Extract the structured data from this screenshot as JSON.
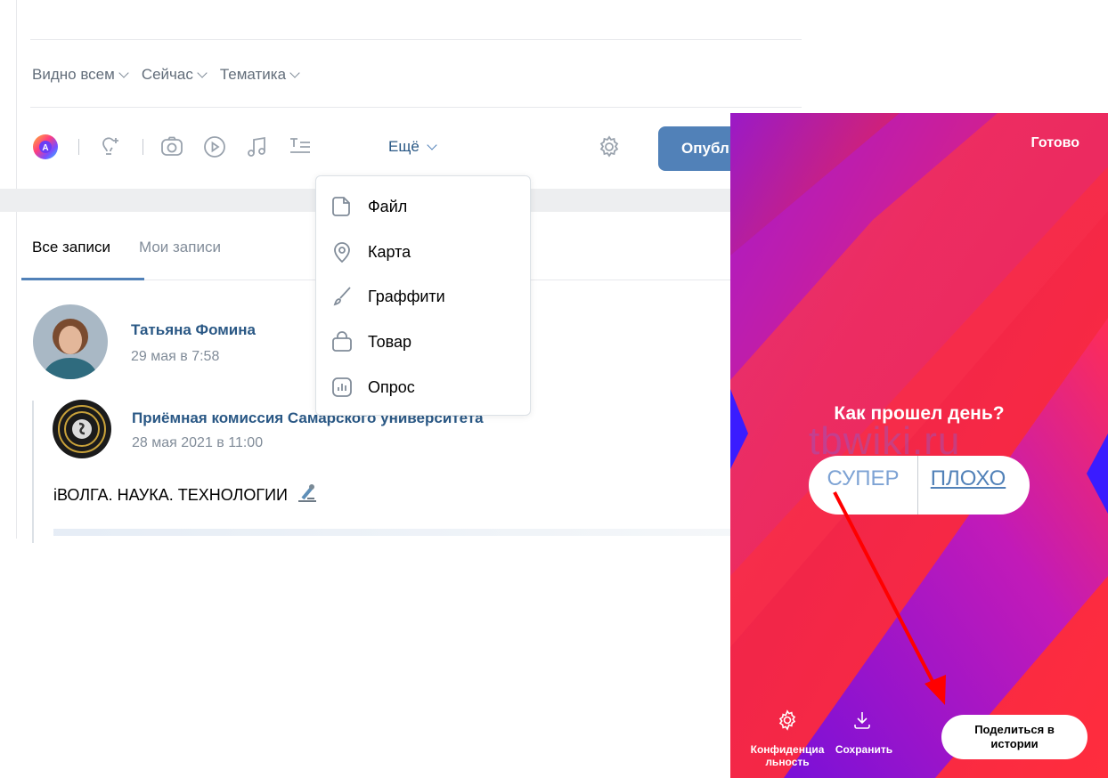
{
  "colors": {
    "accent": "#5181b8",
    "link": "#2a5885",
    "muted": "#818c99",
    "arrow": "#ff0000"
  },
  "composer": {
    "privacy_options": [
      {
        "label": "Видно всем"
      },
      {
        "label": "Сейчас"
      },
      {
        "label": "Тематика"
      }
    ],
    "toolbar_icons": [
      "avatar-gradient-icon",
      "lightbulb-plus-icon",
      "camera-icon",
      "video-icon",
      "music-icon",
      "text-format-icon"
    ],
    "more_label": "Ещё",
    "settings_icon": "gear-icon",
    "publish_label": "Опубли"
  },
  "more_menu": {
    "items": [
      {
        "label": "Файл",
        "icon": "file-icon"
      },
      {
        "label": "Карта",
        "icon": "map-pin-icon"
      },
      {
        "label": "Граффити",
        "icon": "brush-icon"
      },
      {
        "label": "Товар",
        "icon": "shopping-bag-icon"
      },
      {
        "label": "Опрос",
        "icon": "poll-icon"
      }
    ]
  },
  "feed": {
    "tabs": [
      {
        "label": "Все записи",
        "active": true
      },
      {
        "label": "Мои записи",
        "active": false
      }
    ],
    "post": {
      "author": "Татьяна Фомина",
      "time": "29 мая в 7:58",
      "repost": {
        "author": "Приёмная комиссия Самарского университета",
        "time": "28 мая 2021 в 11:00",
        "text": "iВОЛГА. НАУКА. ТЕХНОЛОГИИ"
      }
    }
  },
  "story": {
    "done_label": "Готово",
    "question": "Как прошел день?",
    "watermark": "tbwiki.ru",
    "options": [
      "СУПЕР",
      "ПЛОХО"
    ],
    "privacy_label": "Конфиденциальность",
    "privacy_label_line1": "Конфиденциа",
    "privacy_label_line2": "льность",
    "save_label": "Сохранить",
    "share_label_line1": "Поделиться в",
    "share_label_line2": "истории"
  }
}
